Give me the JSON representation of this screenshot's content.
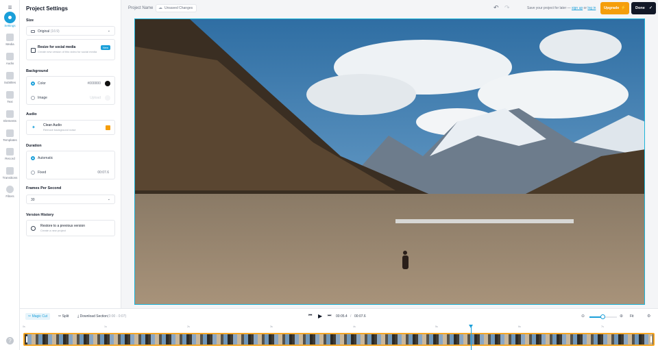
{
  "rail": {
    "items": [
      {
        "label": "Settings",
        "icon": "gear-icon",
        "active": true
      },
      {
        "label": "Media",
        "icon": "media-icon"
      },
      {
        "label": "Audio",
        "icon": "music-icon"
      },
      {
        "label": "Subtitles",
        "icon": "subtitles-icon"
      },
      {
        "label": "Text",
        "icon": "text-icon"
      },
      {
        "label": "Elements",
        "icon": "elements-icon"
      },
      {
        "label": "Templates",
        "icon": "templates-icon"
      },
      {
        "label": "Record",
        "icon": "record-icon"
      },
      {
        "label": "Transitions",
        "icon": "transitions-icon"
      },
      {
        "label": "Filters",
        "icon": "filters-icon"
      }
    ],
    "help": "?"
  },
  "panel": {
    "title": "Project Settings",
    "size": {
      "title": "Size",
      "select_value": "Original",
      "select_ratio": "(16:9)",
      "resize_title": "Resize for social media",
      "resize_desc": "Create new version of this video for social media",
      "badge": "New"
    },
    "background": {
      "title": "Background",
      "color_label": "Color",
      "color_value": "#000000",
      "image_label": "Image",
      "image_value": "Upload"
    },
    "audio": {
      "title": "Audio",
      "clean_title": "Clean Audio",
      "clean_desc": "Remove background noise"
    },
    "duration": {
      "title": "Duration",
      "auto_label": "Automatic",
      "fixed_label": "Fixed",
      "fixed_value": "00:07.6"
    },
    "fps": {
      "title": "Frames Per Second",
      "value": "30"
    },
    "history": {
      "title": "Version History",
      "restore_title": "Restore to a previous version",
      "restore_desc": "Create a new project"
    }
  },
  "topbar": {
    "project_name": "Project Name",
    "unsaved": "Unsaved Changes",
    "save_prefix": "Save your project for later —",
    "sign_up": "sign up",
    "or": "or",
    "log_in": "log in",
    "upgrade": "Upgrade",
    "done": "Done"
  },
  "timeline": {
    "magic_cut": "Magic Cut",
    "split": "Split",
    "download": "Download Section",
    "download_range": "(0:00 - 0:07)",
    "current_time": "00:05.4",
    "separator": "/",
    "total_time": "00:07.6",
    "fit": "Fit",
    "zoom_level": 0.45,
    "ruler": [
      "0s",
      "1s",
      "2s",
      "3s",
      "4s",
      "5s",
      "6s",
      "7s"
    ]
  },
  "colors": {
    "accent": "#1a9fd9",
    "upgrade": "#f59e0b",
    "done": "#111827",
    "canvas_border": "#1ab4d9",
    "clip_border": "#f5a623"
  }
}
